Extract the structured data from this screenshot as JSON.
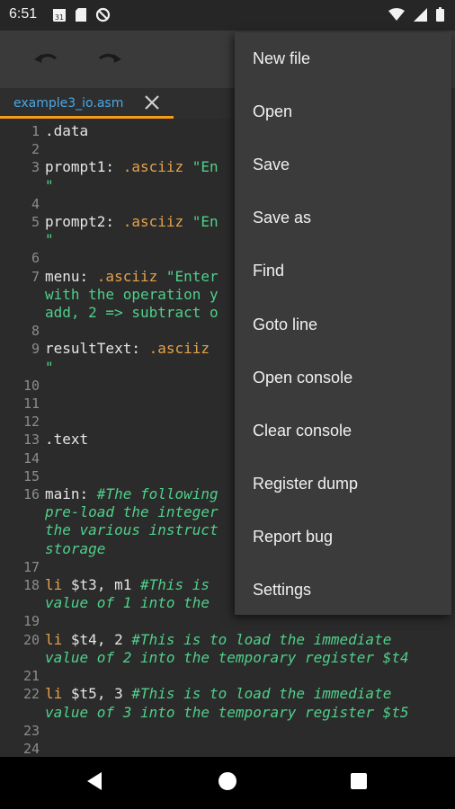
{
  "status": {
    "time": "6:51",
    "left_icons": [
      "calendar-icon",
      "sd-card-icon",
      "data-saver-icon"
    ],
    "right_icons": [
      "wifi-icon",
      "signal-icon",
      "battery-icon"
    ],
    "calendar_day": "31"
  },
  "toolbar": {
    "undo_icon": "undo-icon",
    "redo_icon": "redo-icon"
  },
  "tab": {
    "label": "example3_io.asm",
    "accent_color": "#f59b1c"
  },
  "menu": {
    "items": [
      "New file",
      "Open",
      "Save",
      "Save as",
      "Find",
      "Goto line",
      "Open console",
      "Clear console",
      "Register dump",
      "Report bug",
      "Settings"
    ]
  },
  "code": {
    "lines": [
      {
        "n": "1",
        "rows": [
          [
            [
              "dir",
              ".data"
            ]
          ]
        ]
      },
      {
        "n": "2",
        "rows": [
          []
        ]
      },
      {
        "n": "3",
        "rows": [
          [
            [
              "reg",
              "prompt1: "
            ],
            [
              "kw",
              ".asciiz "
            ],
            [
              "str",
              "\"En"
            ]
          ],
          [
            [
              "str",
              "\""
            ]
          ]
        ]
      },
      {
        "n": "4",
        "rows": [
          []
        ]
      },
      {
        "n": "5",
        "rows": [
          [
            [
              "reg",
              "prompt2: "
            ],
            [
              "kw",
              ".asciiz "
            ],
            [
              "str",
              "\"En"
            ]
          ],
          [
            [
              "str",
              "\""
            ]
          ]
        ]
      },
      {
        "n": "6",
        "rows": [
          []
        ]
      },
      {
        "n": "7",
        "rows": [
          [
            [
              "reg",
              "menu: "
            ],
            [
              "kw",
              ".asciiz "
            ],
            [
              "str",
              "\"Enter"
            ]
          ],
          [
            [
              "str",
              "with the operation y"
            ]
          ],
          [
            [
              "str",
              "add, 2 => subtract o"
            ]
          ]
        ]
      },
      {
        "n": "8",
        "rows": [
          []
        ]
      },
      {
        "n": "9",
        "rows": [
          [
            [
              "reg",
              "resultText: "
            ],
            [
              "kw",
              ".asciiz"
            ]
          ],
          [
            [
              "str",
              "\""
            ]
          ]
        ]
      },
      {
        "n": "10",
        "rows": [
          []
        ]
      },
      {
        "n": "11",
        "rows": [
          []
        ]
      },
      {
        "n": "12",
        "rows": [
          []
        ]
      },
      {
        "n": "13",
        "rows": [
          [
            [
              "dir",
              ".text"
            ]
          ]
        ]
      },
      {
        "n": "14",
        "rows": [
          []
        ]
      },
      {
        "n": "15",
        "rows": [
          []
        ]
      },
      {
        "n": "16",
        "rows": [
          [
            [
              "reg",
              "main: "
            ],
            [
              "cm",
              "#The following"
            ]
          ],
          [
            [
              "cm",
              "pre-load the integer"
            ]
          ],
          [
            [
              "cm",
              "the various instruct"
            ]
          ],
          [
            [
              "cm",
              "storage"
            ]
          ]
        ]
      },
      {
        "n": "17",
        "rows": [
          []
        ]
      },
      {
        "n": "18",
        "rows": [
          [
            [
              "kw",
              "li "
            ],
            [
              "reg",
              "$t3"
            ],
            [
              "reg",
              ", m1 "
            ],
            [
              "cm",
              "#This is"
            ]
          ],
          [
            [
              "cm",
              "value of 1 into the"
            ]
          ]
        ]
      },
      {
        "n": "19",
        "rows": [
          []
        ]
      },
      {
        "n": "20",
        "rows": [
          [
            [
              "kw",
              "li "
            ],
            [
              "reg",
              "$t4"
            ],
            [
              "reg",
              ", 2 "
            ],
            [
              "cm",
              "#This is to load the immediate"
            ]
          ],
          [
            [
              "cm",
              "value of 2 into the temporary register $t4"
            ]
          ]
        ]
      },
      {
        "n": "21",
        "rows": [
          []
        ]
      },
      {
        "n": "22",
        "rows": [
          [
            [
              "kw",
              "li "
            ],
            [
              "reg",
              "$t5"
            ],
            [
              "reg",
              ", 3 "
            ],
            [
              "cm",
              "#This is to load the immediate"
            ]
          ],
          [
            [
              "cm",
              "value of 3 into the temporary register $t5"
            ]
          ]
        ]
      },
      {
        "n": "23",
        "rows": [
          []
        ]
      },
      {
        "n": "24",
        "rows": [
          []
        ]
      }
    ]
  },
  "nav": {
    "back_icon": "back-triangle-icon",
    "home_icon": "home-circle-icon",
    "recents_icon": "recents-square-icon"
  }
}
